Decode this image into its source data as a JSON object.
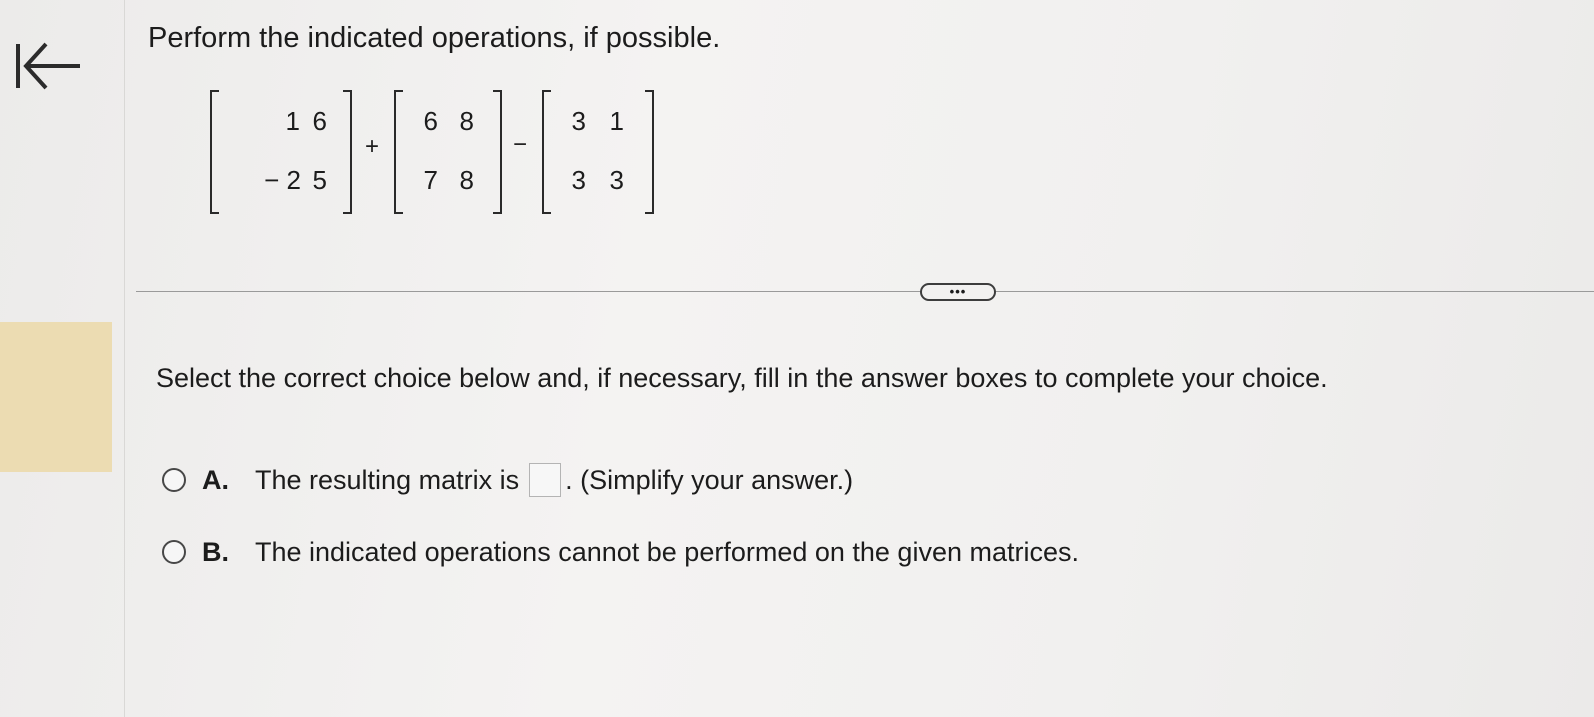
{
  "question": {
    "prompt": "Perform the indicated operations, if possible."
  },
  "expression": {
    "matrix1": [
      [
        "1",
        "6"
      ],
      [
        "− 2",
        "5"
      ]
    ],
    "op1": "+",
    "matrix2": [
      [
        "6",
        "8"
      ],
      [
        "7",
        "8"
      ]
    ],
    "op2": "−",
    "matrix3": [
      [
        "3",
        "1"
      ],
      [
        "3",
        "3"
      ]
    ]
  },
  "toolbar": {
    "more_label": "•••"
  },
  "instruction": "Select the correct choice below and, if necessary, fill in the answer boxes to complete your choice.",
  "choices": [
    {
      "letter": "A.",
      "text_before": "The resulting matrix is",
      "text_after": ". (Simplify your answer.)",
      "answer_value": ""
    },
    {
      "letter": "B.",
      "text": "The indicated operations cannot be performed on the given matrices."
    }
  ],
  "icons": {
    "back": "back-to-start-icon"
  },
  "colors": {
    "side_tab": "#ecdcb2",
    "background": "#f1f0ef"
  }
}
